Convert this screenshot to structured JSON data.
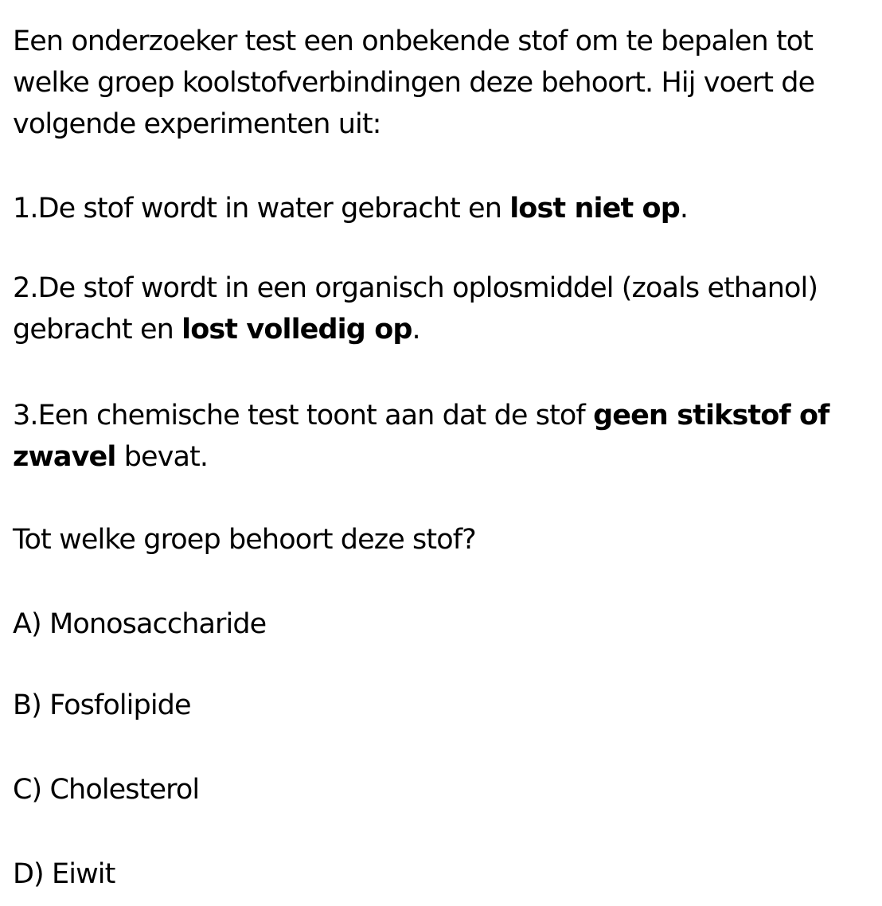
{
  "intro": {
    "line1": "Een onderzoeker test een onbekende stof om te bepalen tot",
    "line2": "welke groep koolstofverbindingen deze behoort. Hij voert de",
    "line3": "volgende experimenten uit:"
  },
  "experiments": [
    {
      "line1_pre": "1.De stof wordt in water gebracht en ",
      "line1_bold": "lost niet op",
      "line1_post": "."
    },
    {
      "line1": "2.De stof wordt in een organisch oplosmiddel (zoals ethanol)",
      "line2_pre": "gebracht en ",
      "line2_bold": "lost volledig op",
      "line2_post": "."
    },
    {
      "line1_pre": "3.Een chemische test toont aan dat de stof ",
      "line1_bold": "geen stikstof of",
      "line2_bold": "zwavel",
      "line2_post": " bevat."
    }
  ],
  "question": "Tot welke groep behoort deze stof?",
  "options": [
    "A) Monosaccharide",
    "B) Fosfolipide",
    "C) Cholesterol",
    "D) Eiwit"
  ]
}
